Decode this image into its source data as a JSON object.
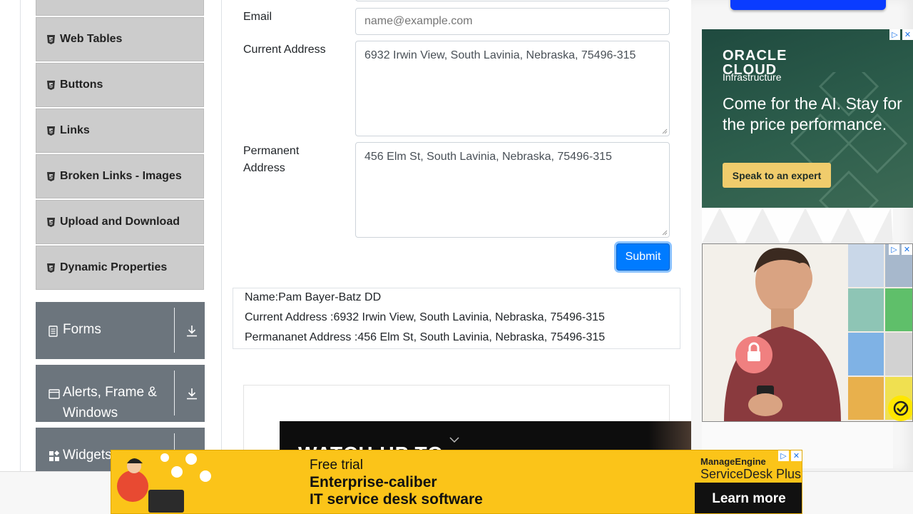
{
  "sidebar": {
    "elements_items": [
      {
        "label": "Web Tables"
      },
      {
        "label": "Buttons"
      },
      {
        "label": "Links"
      },
      {
        "label": "Broken Links - Images"
      },
      {
        "label": "Upload and Download"
      },
      {
        "label": "Dynamic Properties"
      }
    ],
    "groups": [
      {
        "label": "Forms",
        "icon": "form-icon"
      },
      {
        "label": "Alerts, Frame & Windows",
        "icon": "window-icon"
      },
      {
        "label": "Widgets",
        "icon": "widgets-icon"
      }
    ]
  },
  "form": {
    "email_label": "Email",
    "email_placeholder": "name@example.com",
    "current_address_label": "Current Address",
    "current_address_value": "6932 Irwin View, South Lavinia, Nebraska, 75496-315",
    "permanent_address_label": "Permanent Address",
    "permanent_address_value": "456 Elm St, South Lavinia, Nebraska, 75496-315",
    "submit_label": "Submit"
  },
  "output": {
    "name": "Name:Pam Bayer-Batz DD",
    "current_address": "Current Address :6932 Irwin View, South Lavinia, Nebraska, 75496-315",
    "permanent_address": "Permananet Address :456 Elm St, South Lavinia, Nebraska, 75496-315"
  },
  "video_ad": {
    "text": "WATCH UP TO"
  },
  "ads": {
    "oracle_logo_line1": "ORACLE",
    "oracle_logo_line2": "CLOUD",
    "oracle_logo_line3": "Infrastructure",
    "oracle_headline": "Come for the AI. Stay for the price performance.",
    "oracle_cta": "Speak to an expert",
    "banner_line1": "Free trial",
    "banner_line2": "Enterprise-caliber",
    "banner_line3": "IT service desk software",
    "banner_brand1": "ManageEngine",
    "banner_brand2": "ServiceDesk Plus",
    "banner_cta": "Learn more"
  },
  "colors": {
    "primary": "#007bff",
    "sidebar_item_bg": "#cccccc",
    "group_bg": "#6c757d",
    "banner_bg": "#fbc419",
    "oracle_green": "#2d5e4c"
  }
}
